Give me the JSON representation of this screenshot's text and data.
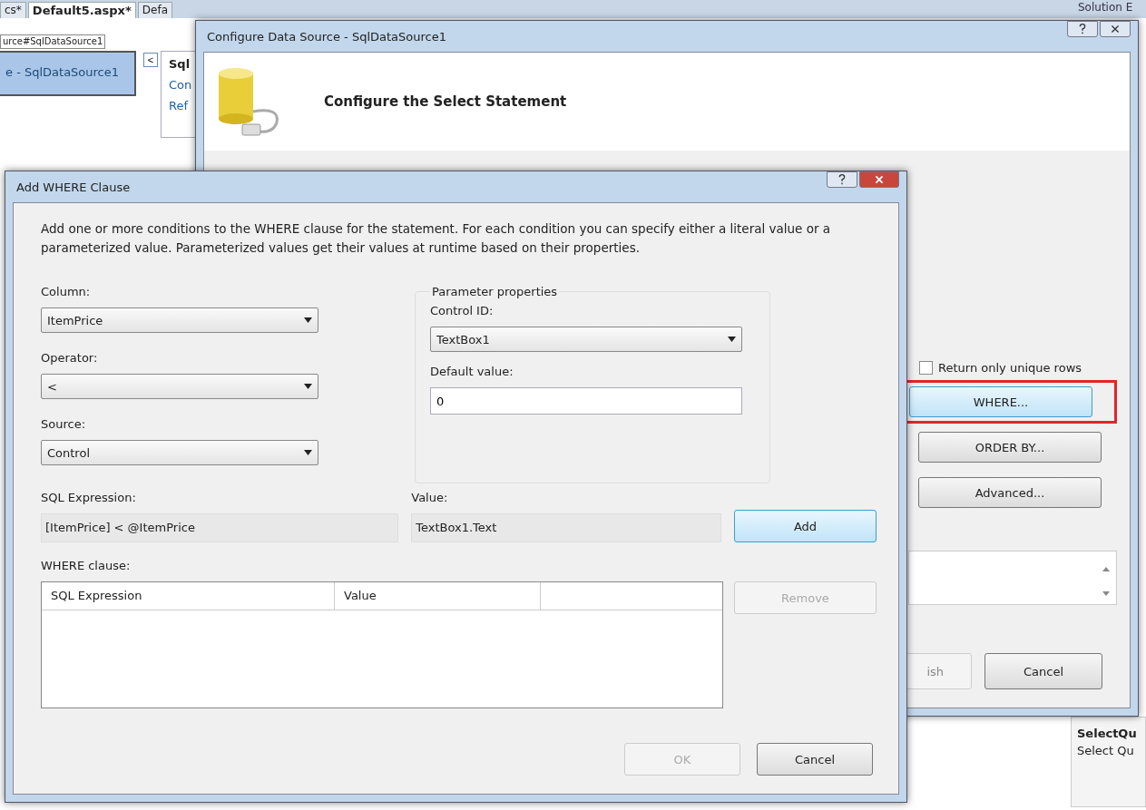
{
  "ide": {
    "tabs": [
      {
        "label": "cs*",
        "selected": false
      },
      {
        "label": "Default5.aspx*",
        "selected": true
      },
      {
        "label": "Defa",
        "selected": false
      }
    ],
    "breadcrumb": "urce#SqlDataSource1",
    "smart_tag": {
      "title": "e - SqlDataSource1",
      "collapse": "<",
      "panel_title": "Sql",
      "links": [
        "Con",
        "Ref"
      ]
    },
    "solution_explorer": "Solution E",
    "properties": {
      "name": "SelectQu",
      "description": "Select Qu"
    }
  },
  "configure_dialog": {
    "title": "Configure Data Source - SqlDataSource1",
    "heading": "Configure the Select Statement",
    "unique_rows": {
      "label": "Return only unique rows",
      "checked": false
    },
    "buttons": [
      {
        "label": "WHERE...",
        "highlighted": true
      },
      {
        "label": "ORDER BY...",
        "highlighted": false
      },
      {
        "label": "Advanced...",
        "highlighted": false
      }
    ],
    "footer_buttons": [
      {
        "label": "ish",
        "disabled": true
      },
      {
        "label": "Cancel",
        "disabled": false
      }
    ]
  },
  "where_dialog": {
    "title": "Add WHERE Clause",
    "description": "Add one or more conditions to the WHERE clause for the statement. For each condition you can specify either a literal value or a parameterized value. Parameterized values get their values at runtime based on their properties.",
    "column": {
      "label": "Column:",
      "value": "ItemPrice"
    },
    "operator": {
      "label": "Operator:",
      "value": "<"
    },
    "source": {
      "label": "Source:",
      "value": "Control"
    },
    "parameter_properties": {
      "title": "Parameter properties",
      "control_id": {
        "label": "Control ID:",
        "value": "TextBox1"
      },
      "default_value": {
        "label": "Default value:",
        "value": "0"
      }
    },
    "sql_expression": {
      "label": "SQL Expression:",
      "value": "[ItemPrice] < @ItemPrice"
    },
    "value": {
      "label": "Value:",
      "value": "TextBox1.Text"
    },
    "add_button": {
      "label": "Add",
      "disabled": false
    },
    "where_clause": {
      "label": "WHERE clause:",
      "columns": [
        "SQL Expression",
        "Value"
      ]
    },
    "remove_button": {
      "label": "Remove",
      "disabled": true
    },
    "ok_button": {
      "label": "OK",
      "disabled": true
    },
    "cancel_button": {
      "label": "Cancel",
      "disabled": false
    }
  }
}
